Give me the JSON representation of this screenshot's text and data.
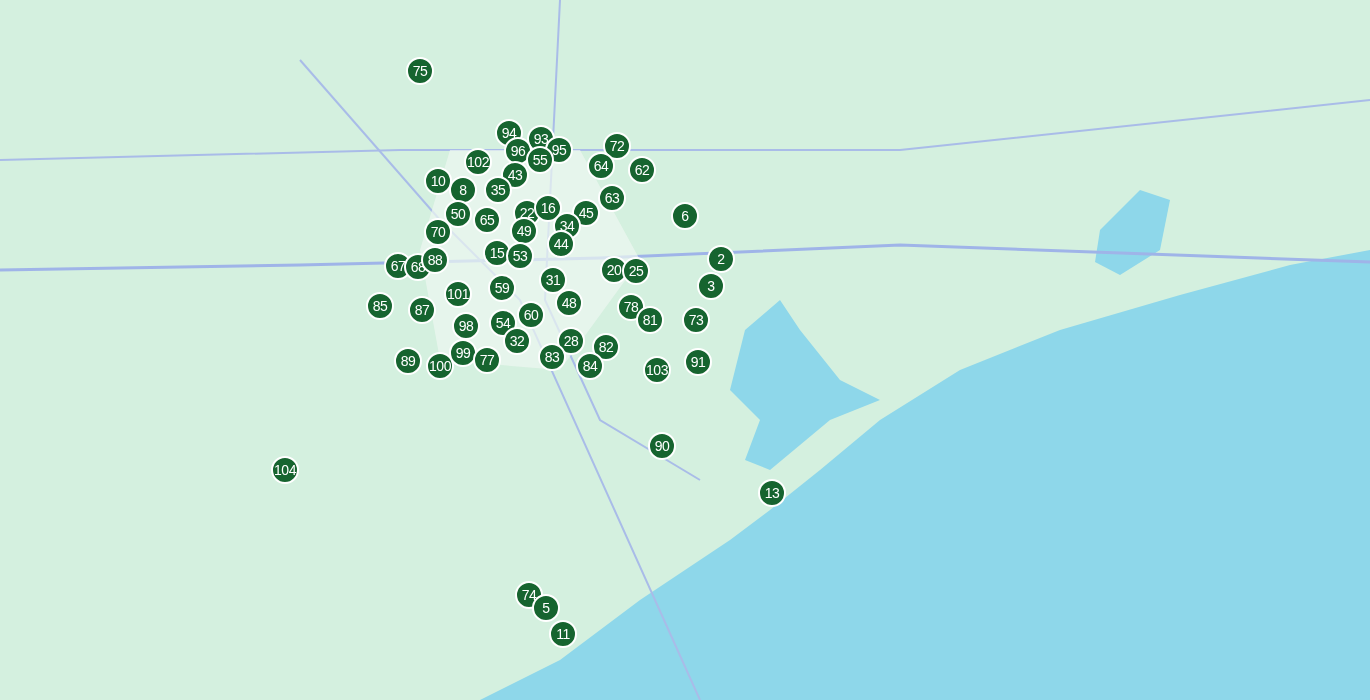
{
  "map": {
    "pins": [
      {
        "label": "75"
      },
      {
        "label": "94"
      },
      {
        "label": "93"
      },
      {
        "label": "96"
      },
      {
        "label": "95"
      },
      {
        "label": "72"
      },
      {
        "label": "102"
      },
      {
        "label": "55"
      },
      {
        "label": "64"
      },
      {
        "label": "62"
      },
      {
        "label": "10"
      },
      {
        "label": "43"
      },
      {
        "label": "8"
      },
      {
        "label": "35"
      },
      {
        "label": "63"
      },
      {
        "label": "50"
      },
      {
        "label": "65"
      },
      {
        "label": "22"
      },
      {
        "label": "16"
      },
      {
        "label": "45"
      },
      {
        "label": "6"
      },
      {
        "label": "70"
      },
      {
        "label": "49"
      },
      {
        "label": "34"
      },
      {
        "label": "44"
      },
      {
        "label": "67"
      },
      {
        "label": "68"
      },
      {
        "label": "88"
      },
      {
        "label": "15"
      },
      {
        "label": "53"
      },
      {
        "label": "20"
      },
      {
        "label": "25"
      },
      {
        "label": "2"
      },
      {
        "label": "31"
      },
      {
        "label": "3"
      },
      {
        "label": "101"
      },
      {
        "label": "59"
      },
      {
        "label": "85"
      },
      {
        "label": "87"
      },
      {
        "label": "48"
      },
      {
        "label": "78"
      },
      {
        "label": "54"
      },
      {
        "label": "60"
      },
      {
        "label": "81"
      },
      {
        "label": "73"
      },
      {
        "label": "98"
      },
      {
        "label": "32"
      },
      {
        "label": "28"
      },
      {
        "label": "82"
      },
      {
        "label": "89"
      },
      {
        "label": "100"
      },
      {
        "label": "99"
      },
      {
        "label": "77"
      },
      {
        "label": "83"
      },
      {
        "label": "84"
      },
      {
        "label": "103"
      },
      {
        "label": "91"
      },
      {
        "label": "90"
      },
      {
        "label": "104"
      },
      {
        "label": "13"
      },
      {
        "label": "74"
      },
      {
        "label": "5"
      },
      {
        "label": "11"
      }
    ]
  }
}
